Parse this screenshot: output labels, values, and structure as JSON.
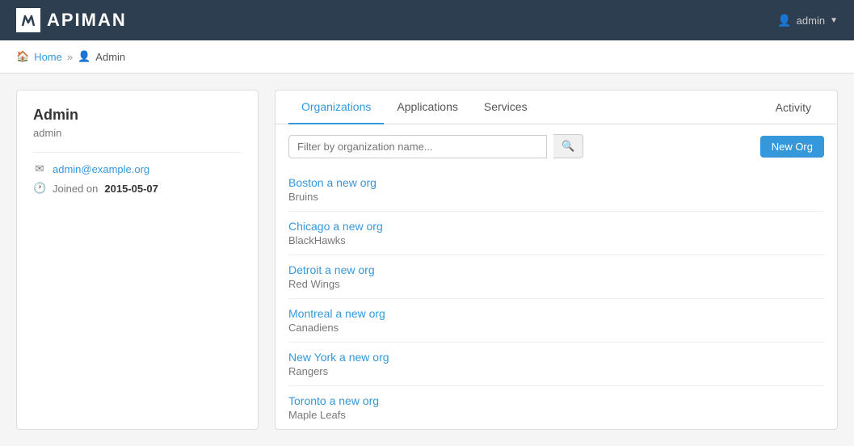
{
  "navbar": {
    "brand": "APIMAN",
    "user_label": "admin",
    "user_icon": "👤",
    "caret": "▼"
  },
  "breadcrumb": {
    "home_label": "Home",
    "separator": "»",
    "admin_icon": "👤",
    "current": "Admin"
  },
  "user_panel": {
    "title": "Admin",
    "handle": "admin",
    "email_icon": "✉",
    "email": "admin@example.org",
    "joined_icon": "🕐",
    "joined_label": "Joined on",
    "joined_date": "2015-05-07"
  },
  "tabs": {
    "organizations": "Organizations",
    "applications": "Applications",
    "services": "Services",
    "activity": "Activity"
  },
  "toolbar": {
    "filter_placeholder": "Filter by organization name...",
    "search_icon": "🔍",
    "new_org_label": "New Org"
  },
  "organizations": [
    {
      "name": "Boston a new org",
      "sub": "Bruins"
    },
    {
      "name": "Chicago a new org",
      "sub": "BlackHawks"
    },
    {
      "name": "Detroit a new org",
      "sub": "Red Wings"
    },
    {
      "name": "Montreal a new org",
      "sub": "Canadiens"
    },
    {
      "name": "New York a new org",
      "sub": "Rangers"
    },
    {
      "name": "Toronto a new org",
      "sub": "Maple Leafs"
    }
  ]
}
